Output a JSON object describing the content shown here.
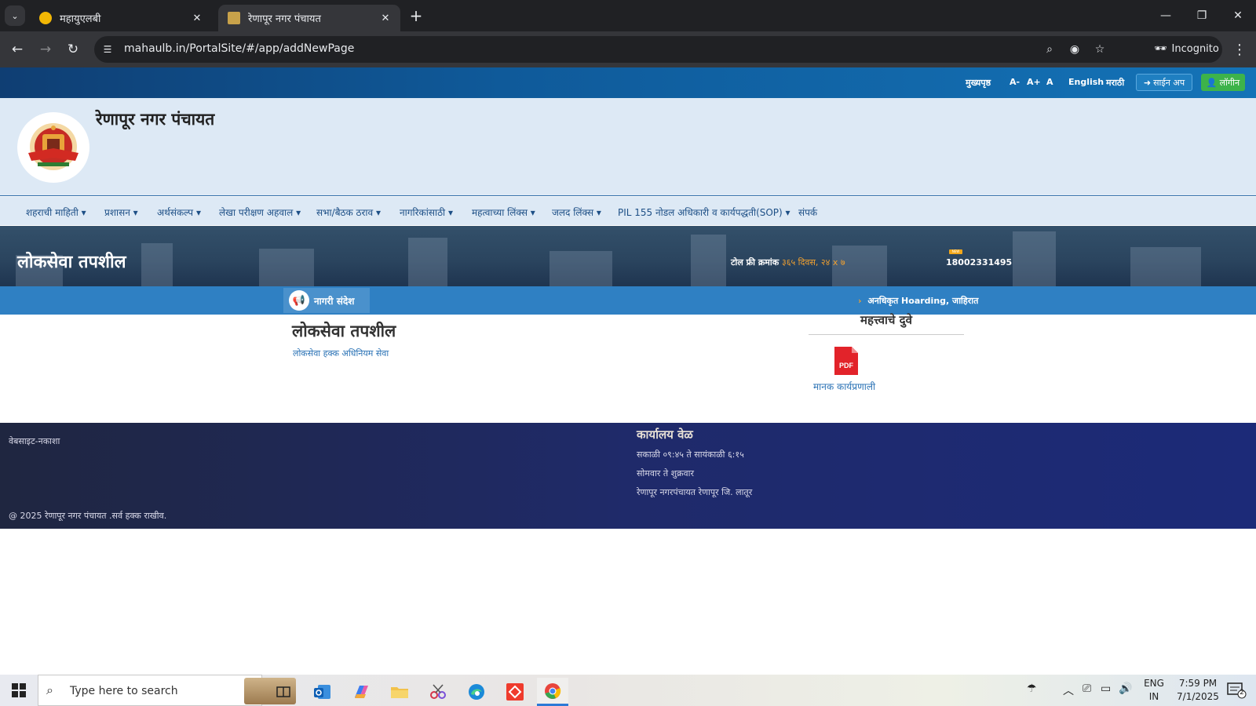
{
  "browser": {
    "tabs": [
      {
        "title": "महायुएलबी",
        "favicon_color": "#f2b705"
      },
      {
        "title": "रेणापूर नगर पंचायत",
        "favicon_color": "#c8a24a"
      }
    ],
    "url": "mahaulb.in/PortalSite/#/app/addNewPage",
    "incognito_label": "Incognito"
  },
  "topbar": {
    "home": "मुख्यपृष्ठ",
    "font_smaller": "A-",
    "font_larger": "A+",
    "font_normal": "A",
    "lang_english": "English",
    "lang_marathi": "मराठी",
    "signup": "साईन अप",
    "login": "लॉगीन"
  },
  "header": {
    "site_title": "रेणापूर नगर पंचायत"
  },
  "nav": {
    "items": [
      "शहराची माहिती ▾",
      "प्रशासन ▾",
      "अर्थसंकल्प ▾",
      "लेखा परीक्षण अहवाल ▾",
      "सभा/बैठक ठराव ▾",
      "नागरिकांसाठी ▾",
      "महत्वाच्या लिंक्स ▾",
      "जलद लिंक्स ▾",
      "PIL 155 नोडल अधिकारी व कार्यपद्धती(SOP) ▾",
      "संपर्क"
    ]
  },
  "banner": {
    "title": "लोकसेवा तपशील",
    "tollfree_label": "टोल फ्री क्रमांक",
    "tollfree_hours": "३६५ दिवस, २४ x ७",
    "tollfree_number": "18002331495",
    "new_badge": "NEW"
  },
  "notice": {
    "label": "नागरी संदेश",
    "ticker": "अनधिकृत Hoarding, जाहिरात"
  },
  "main": {
    "title": "लोकसेवा तपशील",
    "subtitle": "लोकसेवा हक्क अधिनियम सेवा",
    "links_title": "महत्त्वाचे दुवे",
    "pdf_badge": "PDF",
    "pdf_label": "मानक कार्यप्रणाली"
  },
  "footer": {
    "sitemap": "वेबसाइट-नकाशा",
    "office_title": "कार्यालय वेळ",
    "office_hours": "सकाळी ०९:४५ ते सायंकाळी ६:१५",
    "office_days": "सोमवार ते शुक्रवार",
    "office_address": "रेणापूर नगरपंचायत रेणापूर जि. लातूर",
    "copyright": "@ 2025 रेणापूर नगर पंचायत .सर्व हक्क राखीव."
  },
  "taskbar": {
    "search_placeholder": "Type here to search",
    "lang_top": "ENG",
    "lang_bottom": "IN",
    "time": "7:59 PM",
    "date": "7/1/2025",
    "notification_count": "2"
  },
  "colors": {
    "brand_blue": "#2f80c3",
    "nav_text": "#1d4f86",
    "login_green": "#3db34a",
    "pdf_red": "#e2232a",
    "footer_navy": "#1f2a6a"
  }
}
